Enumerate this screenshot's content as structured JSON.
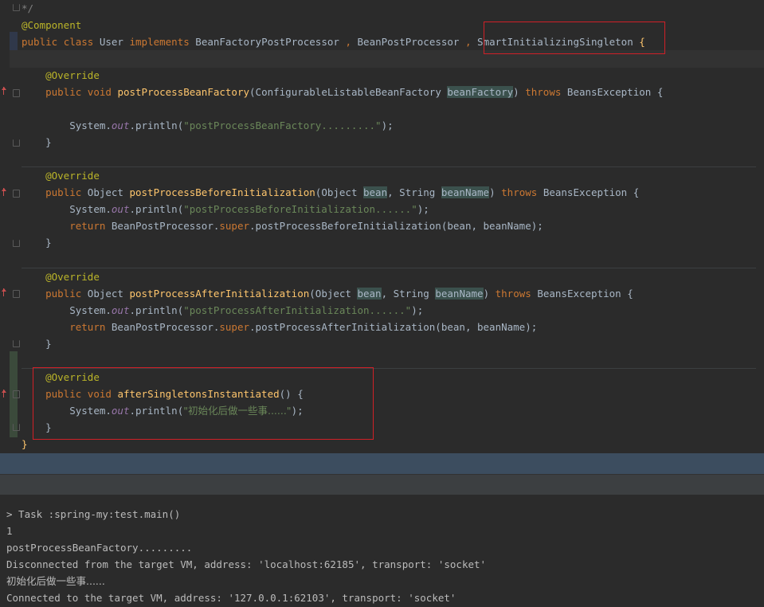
{
  "editor": {
    "code": {
      "comment_end": "*/",
      "component_annotation": "@Component",
      "kw_public": "public",
      "kw_class": "class",
      "class_name": "User",
      "kw_implements": "implements",
      "iface_bfpp": "BeanFactoryPostProcessor",
      "iface_bpp": "BeanPostProcessor",
      "iface_sis": "SmartInitializingSingleton",
      "comma": ",",
      "open_brace": "{",
      "close_brace": "}",
      "override": "@Override",
      "kw_void": "void",
      "kw_throws": "throws",
      "kw_return": "return",
      "kw_super": "super",
      "type_object": "Object",
      "type_string": "String",
      "exception": "BeansException",
      "system": "System.",
      "out": "out",
      "println": ".println(",
      "close_call": ");",
      "m1_name": "postProcessBeanFactory",
      "m1_param_type": "ConfigurableListableBeanFactory",
      "m1_param": "beanFactory",
      "m1_str": "\"postProcessBeanFactory.........\"",
      "m2_name": "postProcessBeforeInitialization",
      "param_bean": "bean",
      "param_beanName": "beanName",
      "m2_str": "\"postProcessBeforeInitialization......\"",
      "m2_return": "BeanPostProcessor.",
      "m2_call": ".postProcessBeforeInitialization(bean, beanName);",
      "m3_name": "postProcessAfterInitialization",
      "m3_str": "\"postProcessAfterInitialization......\"",
      "m3_call": ".postProcessAfterInitialization(bean, beanName);",
      "m4_name": "afterSingletonsInstantiated",
      "m4_parens": "() ",
      "m4_str": "\"初始化后做一些事......\""
    }
  },
  "console": {
    "lines": [
      "> Task :spring-my:test.main()",
      "1",
      "postProcessBeanFactory.........",
      "Disconnected from the target VM, address: 'localhost:62185', transport: 'socket'",
      "初始化后做一些事......",
      "Connected to the target VM, address: '127.0.0.1:62103', transport: 'socket'"
    ]
  },
  "colors": {
    "editor_bg": "#2b2b2b",
    "keyword": "#cc7832",
    "annotation": "#bbb529",
    "string": "#6a8759",
    "method_decl": "#ffc66d",
    "static_field": "#9876aa",
    "highlight_box": "#d02027"
  }
}
